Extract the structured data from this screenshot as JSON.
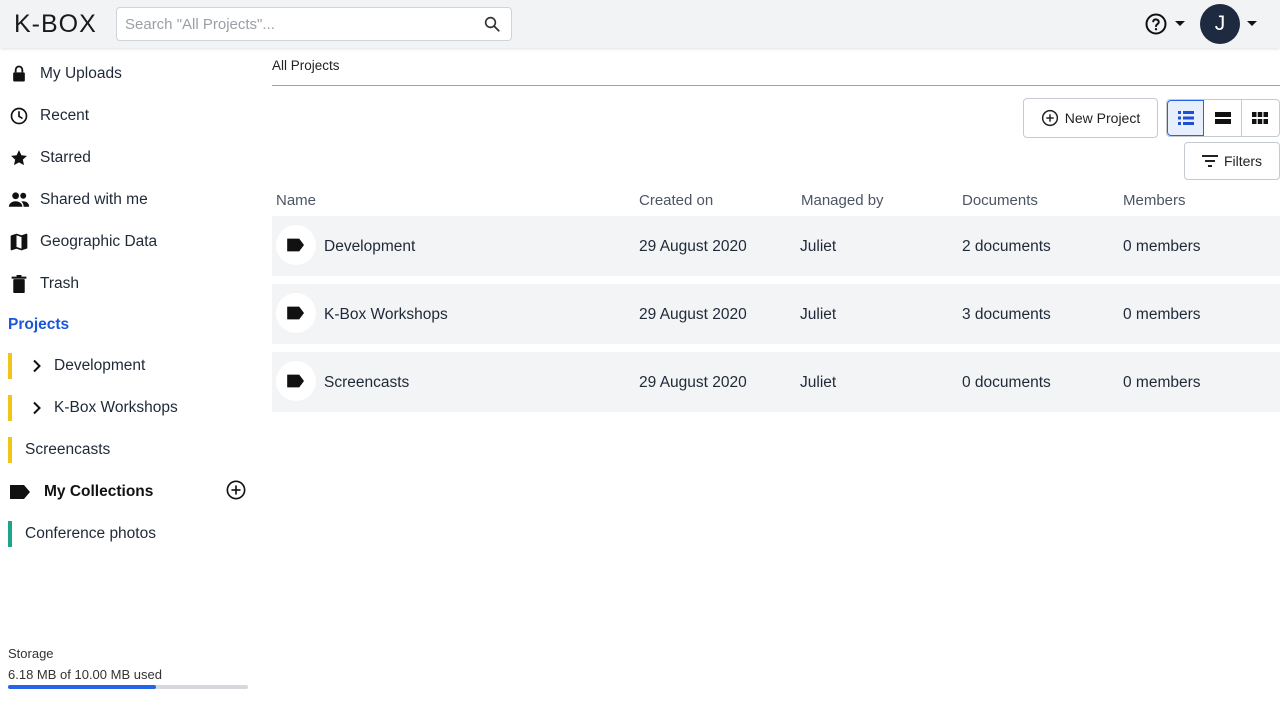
{
  "header": {
    "logo": "K-BOX",
    "search_placeholder": "Search \"All Projects\"...",
    "avatar_initial": "J"
  },
  "sidebar": {
    "nav": [
      {
        "label": "My Uploads",
        "icon": "lock-icon"
      },
      {
        "label": "Recent",
        "icon": "clock-icon"
      },
      {
        "label": "Starred",
        "icon": "star-icon"
      },
      {
        "label": "Shared with me",
        "icon": "people-icon"
      },
      {
        "label": "Geographic Data",
        "icon": "map-icon"
      },
      {
        "label": "Trash",
        "icon": "trash-icon"
      }
    ],
    "projects_title": "Projects",
    "projects": [
      {
        "label": "Development",
        "expandable": true
      },
      {
        "label": "K-Box Workshops",
        "expandable": true
      },
      {
        "label": "Screencasts",
        "expandable": false
      }
    ],
    "collections_title": "My Collections",
    "collections": [
      {
        "label": "Conference photos"
      }
    ],
    "storage": {
      "label": "Storage",
      "used_text": "6.18 MB of 10.00 MB used",
      "used_fraction": 0.618
    },
    "colors": {
      "accent": "#1a56db",
      "project_marker": "#f0c419",
      "collection_marker": "#1fa38a"
    }
  },
  "main": {
    "breadcrumb": "All Projects",
    "new_project_label": "New Project",
    "filters_label": "Filters",
    "columns": {
      "name": "Name",
      "created": "Created on",
      "managed": "Managed by",
      "documents": "Documents",
      "members": "Members"
    },
    "rows": [
      {
        "name": "Development",
        "created": "29 August 2020",
        "managed": "Juliet",
        "documents": "2 documents",
        "members": "0 members"
      },
      {
        "name": "K-Box Workshops",
        "created": "29 August 2020",
        "managed": "Juliet",
        "documents": "3 documents",
        "members": "0 members"
      },
      {
        "name": "Screencasts",
        "created": "29 August 2020",
        "managed": "Juliet",
        "documents": "0 documents",
        "members": "0 members"
      }
    ]
  }
}
